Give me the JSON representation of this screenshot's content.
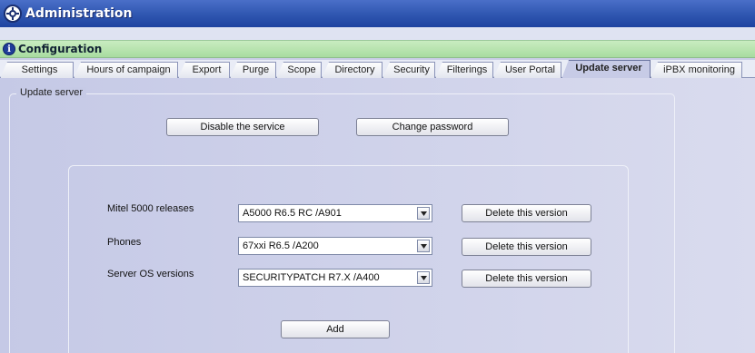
{
  "window": {
    "title": "Administration"
  },
  "section": {
    "title": "Configuration"
  },
  "tabs": [
    {
      "label": "Settings"
    },
    {
      "label": "Hours of campaign"
    },
    {
      "label": "Export"
    },
    {
      "label": "Purge"
    },
    {
      "label": "Scope"
    },
    {
      "label": "Directory"
    },
    {
      "label": "Security"
    },
    {
      "label": "Filterings"
    },
    {
      "label": "User Portal"
    },
    {
      "label": "Update server",
      "active": true
    },
    {
      "label": "iPBX monitoring"
    }
  ],
  "group": {
    "legend": "Update server"
  },
  "actions": {
    "disable_label": "Disable the service",
    "change_password_label": "Change password"
  },
  "rows": [
    {
      "label": "Mitel 5000 releases",
      "value": "A5000 R6.5 RC /A901",
      "delete_label": "Delete this version"
    },
    {
      "label": "Phones",
      "value": "67xxi R6.5 /A200",
      "delete_label": "Delete this version"
    },
    {
      "label": "Server OS versions",
      "value": "SECURITYPATCH R7.X /A400",
      "delete_label": "Delete this version"
    }
  ],
  "add_label": "Add",
  "colors": {
    "titlebar": "#2f56b0",
    "configbar": "#b5e2ad",
    "panel": "#c9cde6"
  }
}
